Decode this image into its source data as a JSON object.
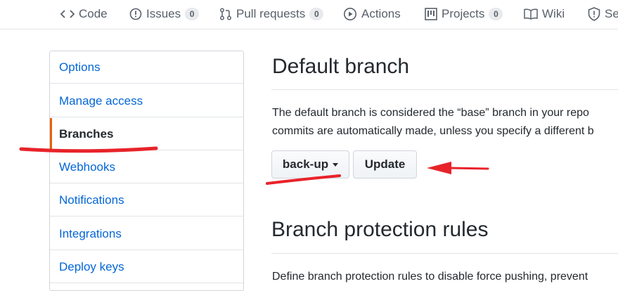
{
  "nav": {
    "tabs": [
      {
        "label": "Code",
        "icon": "code-icon"
      },
      {
        "label": "Issues",
        "icon": "issue-icon",
        "count": "0"
      },
      {
        "label": "Pull requests",
        "icon": "pull-request-icon",
        "count": "0"
      },
      {
        "label": "Actions",
        "icon": "play-icon"
      },
      {
        "label": "Projects",
        "icon": "project-icon",
        "count": "0"
      },
      {
        "label": "Wiki",
        "icon": "book-icon"
      },
      {
        "label": "Se",
        "icon": "shield-icon"
      }
    ]
  },
  "sidebar": {
    "items": [
      {
        "label": "Options"
      },
      {
        "label": "Manage access"
      },
      {
        "label": "Branches",
        "selected": true
      },
      {
        "label": "Webhooks"
      },
      {
        "label": "Notifications"
      },
      {
        "label": "Integrations"
      },
      {
        "label": "Deploy keys"
      }
    ]
  },
  "default_branch": {
    "title": "Default branch",
    "desc_line1": "The default branch is considered the “base” branch in your repo",
    "desc_line2": "commits are automatically made, unless you specify a different b",
    "selected_branch": "back-up",
    "update_label": "Update"
  },
  "protection": {
    "title": "Branch protection rules",
    "desc": "Define branch protection rules to disable force pushing, prevent"
  },
  "colors": {
    "link": "#0366d6",
    "selected_accent": "#e36209",
    "annotation": "#e8232a"
  }
}
